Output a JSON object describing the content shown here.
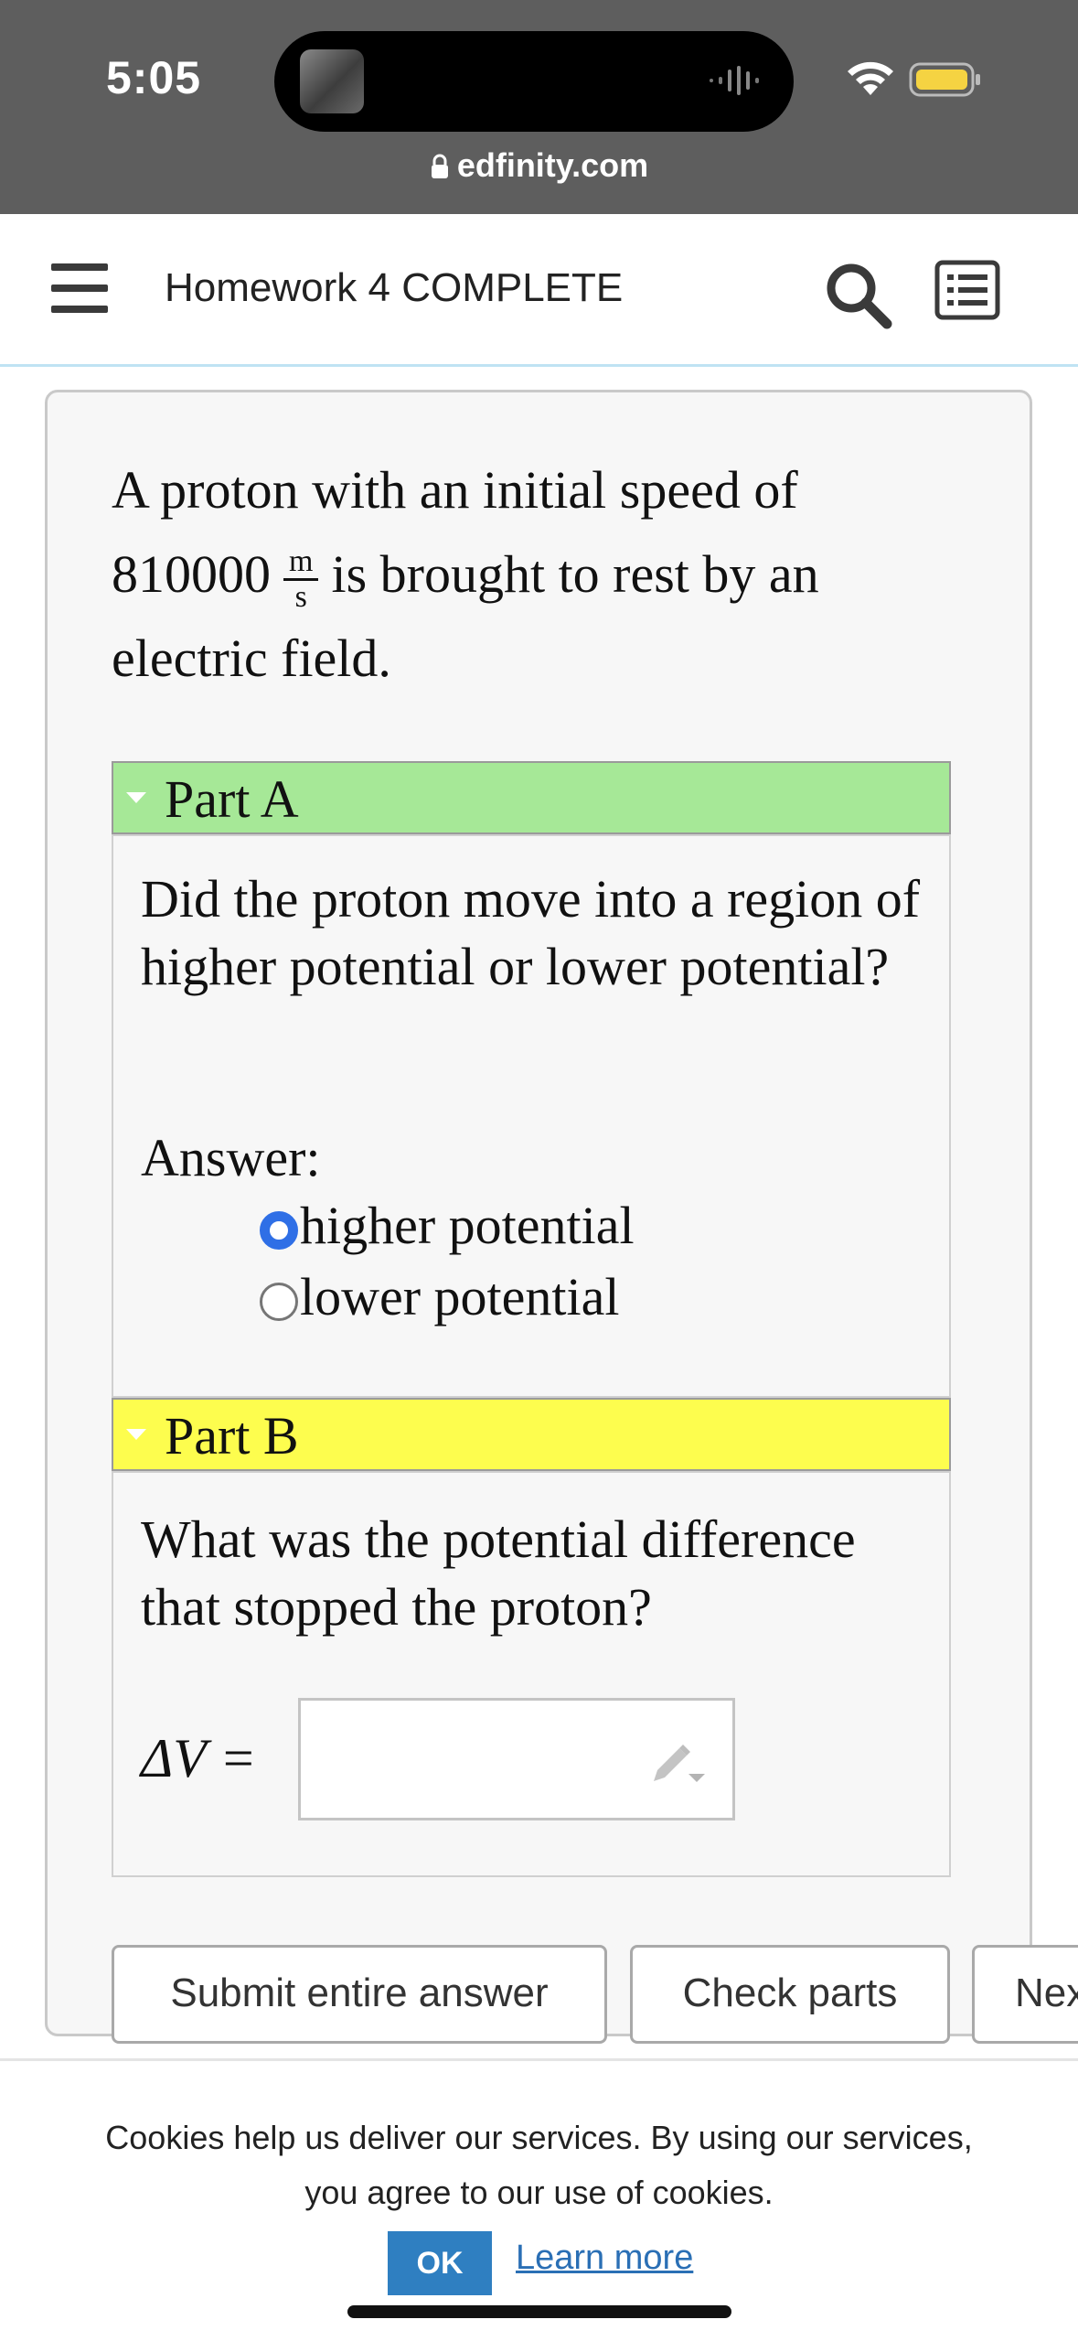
{
  "status_bar": {
    "time": "5:05",
    "url": "edfinity.com"
  },
  "header": {
    "title": "Homework 4 COMPLETE"
  },
  "problem": {
    "text_prefix": "A proton with an initial speed of",
    "speed_value": "810000",
    "unit_numerator": "m",
    "unit_denominator": "s",
    "text_suffix": "is brought to rest by an",
    "text_line3": "electric field."
  },
  "part_a": {
    "label": "Part A",
    "header_color": "#a6e897",
    "question": "Did the proton move into a region of higher potential or lower potential?",
    "answer_label": "Answer:",
    "options": [
      {
        "label": "higher potential",
        "selected": true
      },
      {
        "label": "lower potential",
        "selected": false
      }
    ]
  },
  "part_b": {
    "label": "Part B",
    "header_color": "#fdfd4e",
    "question": "What was the potential difference that stopped the proton?",
    "variable": "ΔV",
    "equals": "=",
    "input_value": ""
  },
  "buttons": {
    "submit": "Submit entire answer",
    "check": "Check parts",
    "next": "Nex"
  },
  "cookie_banner": {
    "line1": "Cookies help us deliver our services. By using our services,",
    "line2": "you agree to our use of cookies.",
    "ok": "OK",
    "learn_more": "Learn more"
  },
  "icons": [
    "menu-icon",
    "search-icon",
    "list-icon",
    "lock-icon",
    "wifi-icon",
    "battery-icon",
    "pencil-icon"
  ]
}
